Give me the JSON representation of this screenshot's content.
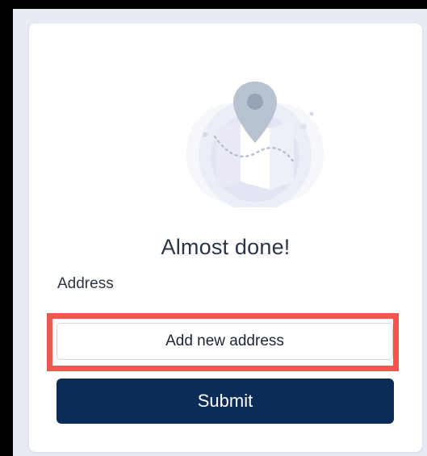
{
  "form": {
    "heading": "Almost done!",
    "address_label": "Address",
    "add_address_label": "Add new address",
    "submit_label": "Submit"
  },
  "colors": {
    "page_background": "#e9ebf3",
    "card_background": "#ffffff",
    "heading_text": "#2c3447",
    "submit_background": "#0c2c58",
    "submit_text": "#ffffff",
    "highlight_border": "#f2574e",
    "pin": "#b9c2d0"
  },
  "icons": {
    "illustration": "map-location-pin-icon"
  }
}
